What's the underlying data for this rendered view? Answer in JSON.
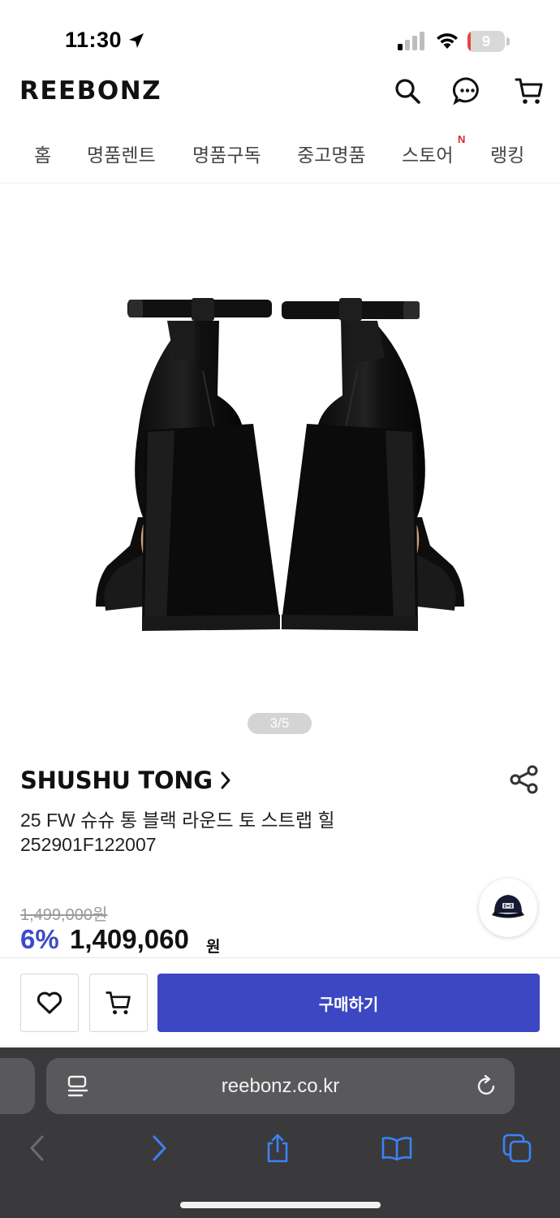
{
  "status_bar": {
    "time": "11:30",
    "battery_level": "9",
    "battery_fraction": 0.09,
    "battery_color": "#e5483c"
  },
  "header": {
    "logo": "REEBONZ",
    "icons": [
      "search-icon",
      "chat-icon",
      "cart-icon"
    ]
  },
  "nav": {
    "tabs": [
      {
        "label": "홈"
      },
      {
        "label": "명품렌트"
      },
      {
        "label": "명품구독"
      },
      {
        "label": "중고명품"
      },
      {
        "label": "스토어",
        "badge": "N"
      },
      {
        "label": "랭킹"
      }
    ]
  },
  "gallery": {
    "counter": "3/5",
    "current_index": 3,
    "total": 5
  },
  "product": {
    "brand": "SHUSHU TONG",
    "brand_chevron": "›",
    "name": "25 FW 슈슈 통 블랙 라운드 토 스트랩 힐",
    "code": "252901F122007",
    "original_price": "1,499,000원",
    "discount_rate": "6%",
    "sale_price": "1,409,060",
    "price_unit": "원"
  },
  "actions": {
    "buy_label": "구매하기",
    "buy_color": "#3d47c3",
    "accent_color": "#3e4bc5"
  },
  "browser": {
    "url": "reebonz.co.kr",
    "toolbar_icons": [
      "back-icon",
      "forward-icon",
      "share-icon",
      "bookmarks-icon",
      "tabs-icon"
    ]
  }
}
